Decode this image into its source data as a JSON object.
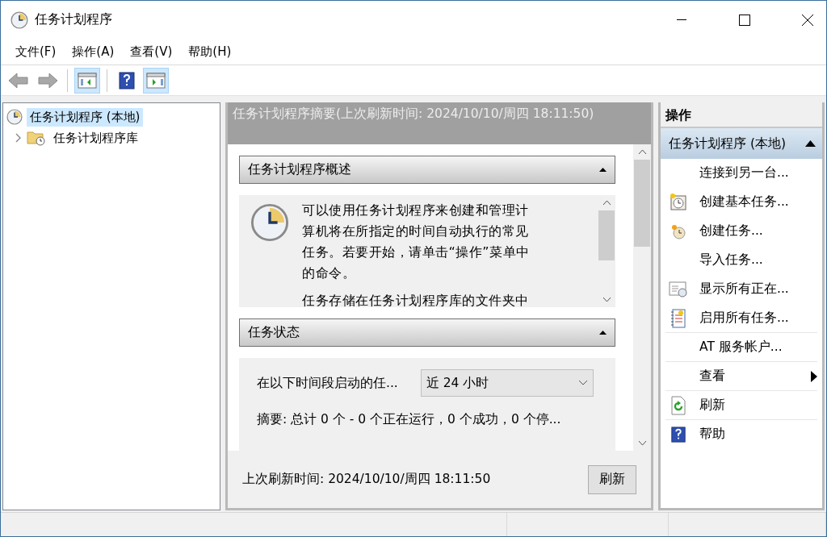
{
  "window": {
    "title": "任务计划程序"
  },
  "menu": [
    {
      "label": "文件(F)"
    },
    {
      "label": "操作(A)"
    },
    {
      "label": "查看(V)"
    },
    {
      "label": "帮助(H)"
    }
  ],
  "nav": [
    {
      "kind": "back",
      "disabled": true
    },
    {
      "kind": "forward",
      "disabled": true
    }
  ],
  "toolbar": [
    {
      "kind": "tree-pane",
      "selected": true
    },
    {
      "kind": "help",
      "selected": false
    },
    {
      "kind": "action-pane",
      "selected": true
    }
  ],
  "tree": [
    {
      "label": "任务计划程序 (本地)",
      "selected": true,
      "children": [
        {
          "label": "任务计划程序库",
          "selected": false,
          "expanded": false
        }
      ]
    }
  ],
  "center": {
    "header": "任务计划程序摘要(上次刷新时间: 2024/10/10/周四 18:11:50)",
    "overview": {
      "title": "任务计划程序概述",
      "expanded": true,
      "paragraphs": [
        "可以使用任务计划程序来创建和管理计算机将在所指定的时间自动执行的常见任务。若要开始，请单击“操作”菜单中的命令。",
        "任务存储在任务计划程序库的文件夹中"
      ]
    },
    "status": {
      "title": "任务状态",
      "expanded": true,
      "filter_label": "在以下时间段启动的任...",
      "filter_value": "近 24 小时",
      "summary": "摘要: 总计 0 个 - 0 个正在运行，0 个成功，0 个停..."
    },
    "footer": {
      "last_refresh": "上次刷新时间: 2024/10/10/周四 18:11:50",
      "button": "刷新"
    }
  },
  "actions": {
    "title": "操作",
    "group": {
      "label": "任务计划程序 (本地)",
      "expanded": true
    },
    "items": [
      {
        "label": "连接到另一台...",
        "kind": "action",
        "separator": false
      },
      {
        "label": "创建基本任务...",
        "kind": "action",
        "separator": false
      },
      {
        "label": "创建任务...",
        "kind": "action",
        "separator": false
      },
      {
        "label": "导入任务...",
        "kind": "action",
        "separator": false
      },
      {
        "label": "显示所有正在...",
        "kind": "action",
        "separator": false
      },
      {
        "label": "启用所有任务...",
        "kind": "action",
        "separator": true
      },
      {
        "label": "AT 服务帐户...",
        "kind": "action",
        "separator": true
      },
      {
        "label": "查看",
        "kind": "submenu",
        "separator": true
      },
      {
        "label": "刷新",
        "kind": "action",
        "separator": true
      },
      {
        "label": "帮助",
        "kind": "action",
        "separator": false
      }
    ]
  }
}
